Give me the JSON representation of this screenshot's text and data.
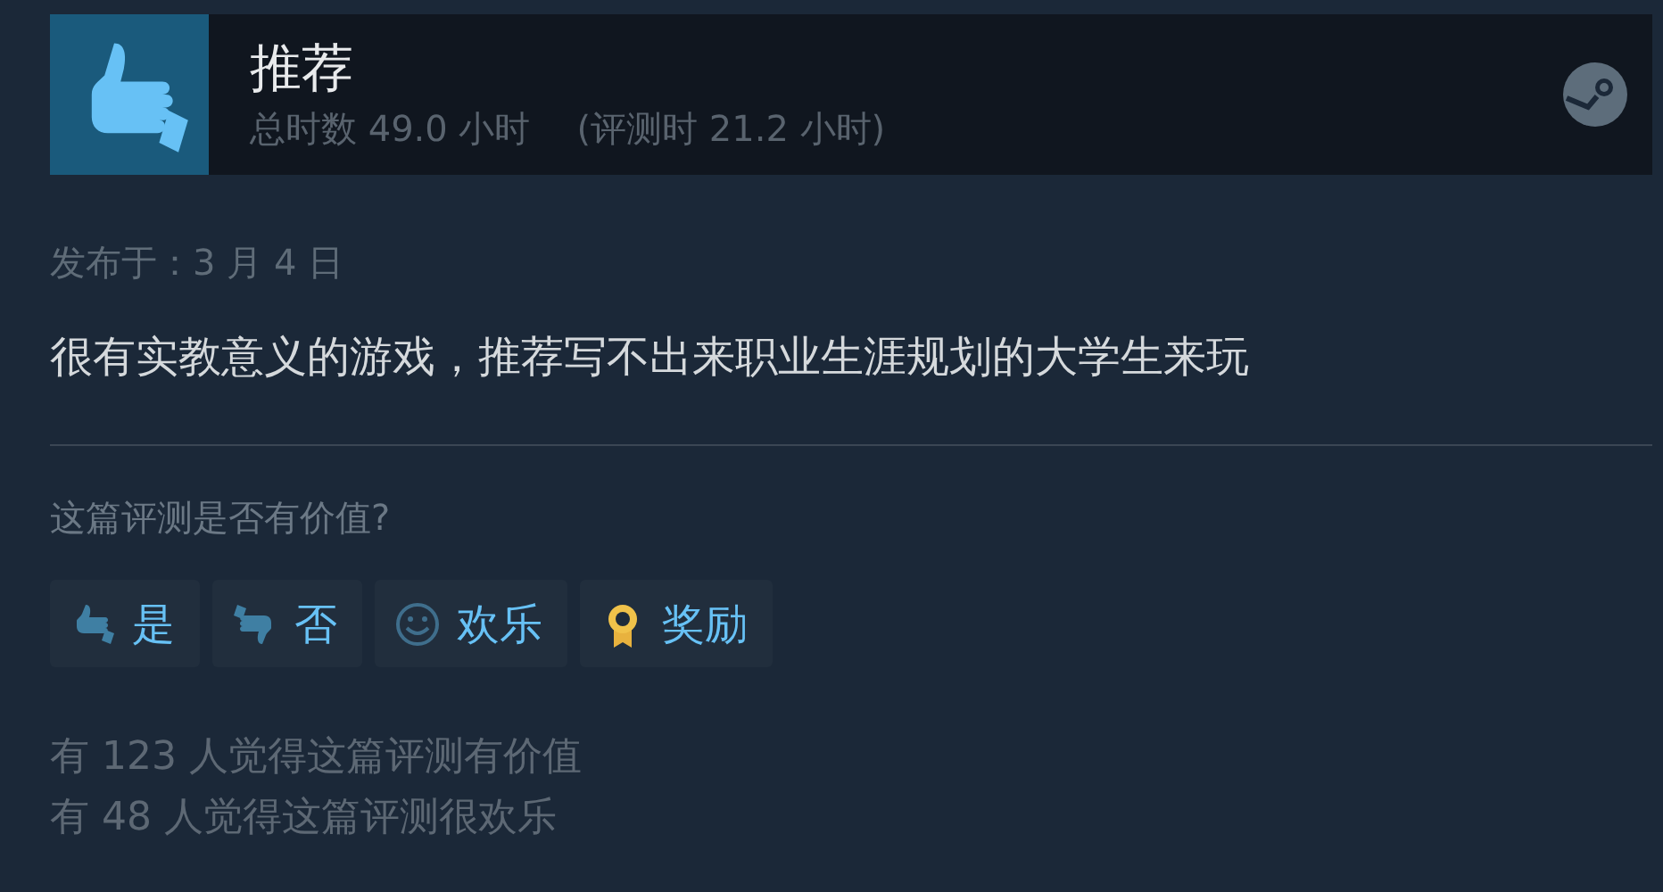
{
  "review": {
    "verdict": "推荐",
    "hours": "总时数 49.0 小时",
    "hours_at_review": "(评测时 21.2 小时)"
  },
  "posted": "发布于：3 月 4 日",
  "text": "很有实教意义的游戏，推荐写不出来职业生涯规划的大学生来玩",
  "question": "这篇评测是否有价值?",
  "buttons": [
    {
      "label": "是",
      "kind": "yes"
    },
    {
      "label": "否",
      "kind": "no"
    },
    {
      "label": "欢乐",
      "kind": "funny"
    },
    {
      "label": "奖励",
      "kind": "award"
    }
  ],
  "counts": [
    "有 123 人觉得这篇评测有价值",
    "有 48 人觉得这篇评测很欢乐"
  ]
}
